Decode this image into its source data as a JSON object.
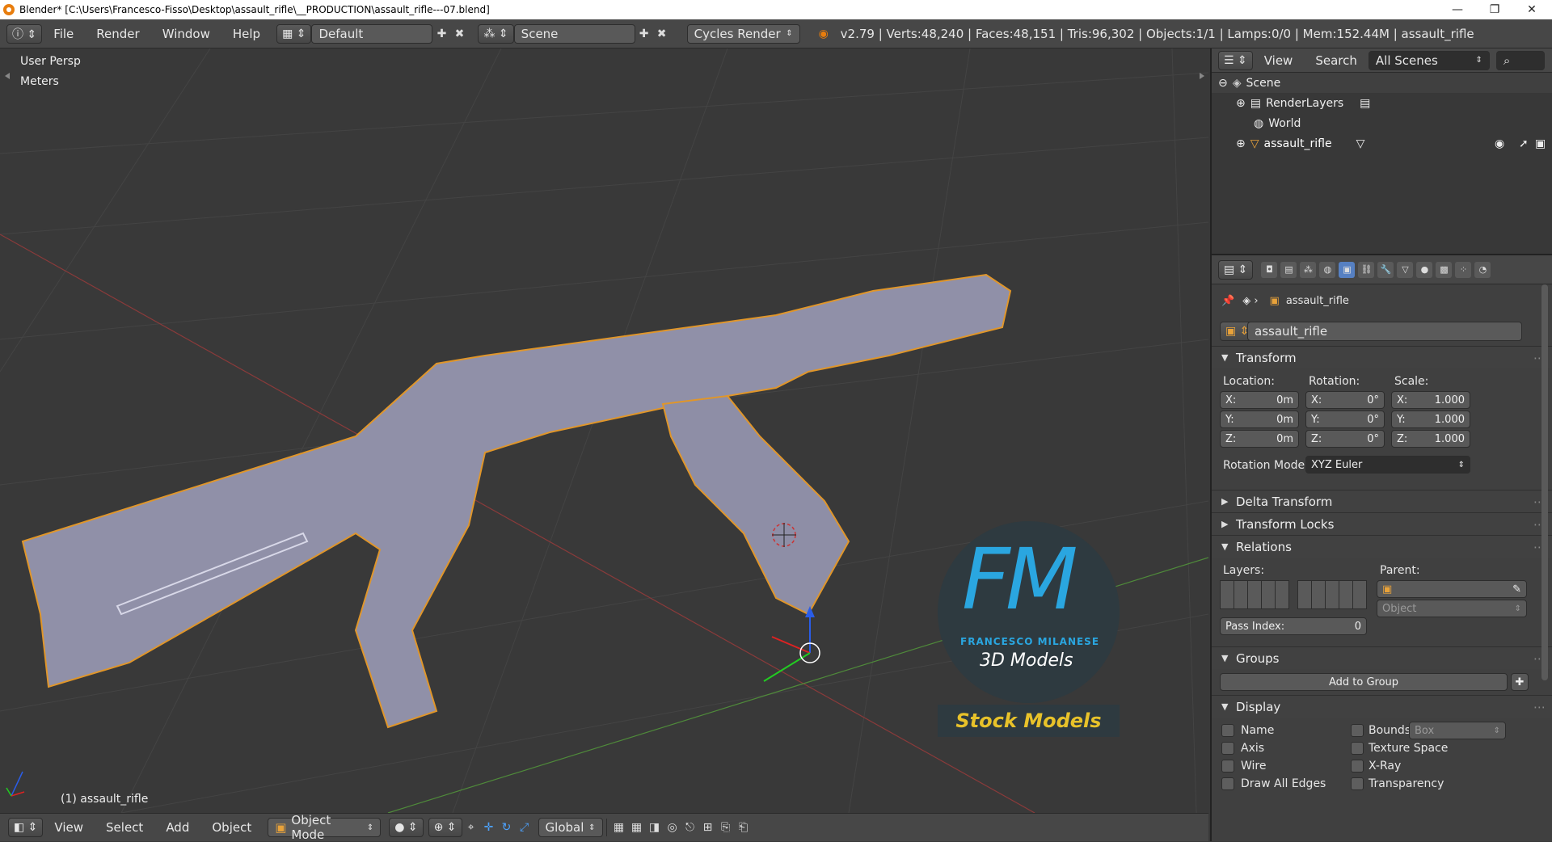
{
  "window": {
    "title": "Blender* [C:\\Users\\Francesco-Fisso\\Desktop\\assault_rifle\\__PRODUCTION\\assault_rifle---07.blend]",
    "minimize": "—",
    "maximize": "❐",
    "close": "✕"
  },
  "topbar": {
    "menus": [
      "File",
      "Render",
      "Window",
      "Help"
    ],
    "layout": "Default",
    "scene": "Scene",
    "engine": "Cycles Render",
    "stats": "v2.79 | Verts:48,240 | Faces:48,151 | Tris:96,302 | Objects:1/1 | Lamps:0/0 | Mem:152.44M | assault_rifle"
  },
  "viewport": {
    "view_name": "User Persp",
    "units": "Meters",
    "object_label": "(1) assault_rifle",
    "watermark": {
      "letters": "FM",
      "line1": "FRANCESCO MILANESE",
      "line2": "3D Models",
      "banner": "Stock Models"
    }
  },
  "outliner": {
    "menus": [
      "View",
      "Search"
    ],
    "filter": "All Scenes",
    "rows": [
      {
        "label": "Scene"
      },
      {
        "label": "RenderLayers"
      },
      {
        "label": "World"
      },
      {
        "label": "assault_rifle"
      }
    ]
  },
  "properties": {
    "breadcrumb": "assault_rifle",
    "object_name": "assault_rifle",
    "transform": {
      "title": "Transform",
      "location_label": "Location:",
      "rotation_label": "Rotation:",
      "scale_label": "Scale:",
      "location": [
        {
          "axis": "X:",
          "value": "0m"
        },
        {
          "axis": "Y:",
          "value": "0m"
        },
        {
          "axis": "Z:",
          "value": "0m"
        }
      ],
      "rotation": [
        {
          "axis": "X:",
          "value": "0°"
        },
        {
          "axis": "Y:",
          "value": "0°"
        },
        {
          "axis": "Z:",
          "value": "0°"
        }
      ],
      "scale": [
        {
          "axis": "X:",
          "value": "1.000"
        },
        {
          "axis": "Y:",
          "value": "1.000"
        },
        {
          "axis": "Z:",
          "value": "1.000"
        }
      ],
      "rotation_mode_label": "Rotation Mode:",
      "rotation_mode": "XYZ Euler"
    },
    "delta_transform": "Delta Transform",
    "transform_locks": "Transform Locks",
    "relations": {
      "title": "Relations",
      "layers_label": "Layers:",
      "parent_label": "Parent:",
      "parent_type": "Object",
      "pass_index_label": "Pass Index:",
      "pass_index": "0"
    },
    "groups": {
      "title": "Groups",
      "add_button": "Add to Group"
    },
    "display": {
      "title": "Display",
      "left": [
        "Name",
        "Axis",
        "Wire",
        "Draw All Edges"
      ],
      "right": [
        "Bounds",
        "Texture Space",
        "X-Ray",
        "Transparency"
      ],
      "bounds_type": "Box"
    }
  },
  "bottombar": {
    "menus": [
      "View",
      "Select",
      "Add",
      "Object"
    ],
    "mode": "Object Mode",
    "orientation": "Global"
  },
  "colors": {
    "accent": "#e87d0d",
    "watermark_blue": "#2aa6e0",
    "banner_text": "#e8c22a"
  }
}
